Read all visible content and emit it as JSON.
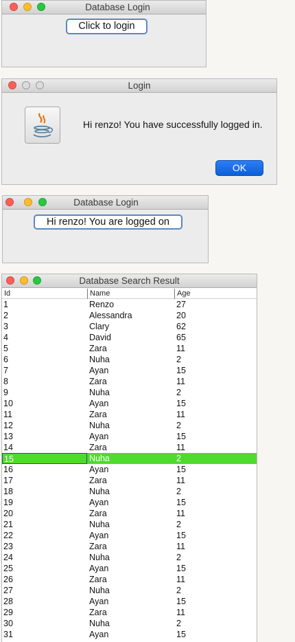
{
  "window1": {
    "title": "Database Login",
    "button_label": "Click to login"
  },
  "dialog": {
    "title": "Login",
    "message": "Hi renzo! You have successfully logged in.",
    "ok_label": "OK",
    "icon": "java-icon"
  },
  "window3": {
    "title": "Database Login",
    "button_label": "Hi renzo!  You are logged on"
  },
  "table_window": {
    "title": "Database Search Result",
    "columns": [
      "Id",
      "Name",
      "Age"
    ],
    "selected_row_id": "15",
    "selection_color": "#4fdb2d",
    "rows": [
      {
        "id": "1",
        "name": "Renzo",
        "age": "27"
      },
      {
        "id": "2",
        "name": "Alessandra",
        "age": "20"
      },
      {
        "id": "3",
        "name": "Clary",
        "age": "62"
      },
      {
        "id": "4",
        "name": "David",
        "age": "65"
      },
      {
        "id": "5",
        "name": "Zara",
        "age": "11"
      },
      {
        "id": "6",
        "name": "Nuha",
        "age": "2"
      },
      {
        "id": "7",
        "name": "Ayan",
        "age": "15"
      },
      {
        "id": "8",
        "name": "Zara",
        "age": "11"
      },
      {
        "id": "9",
        "name": "Nuha",
        "age": "2"
      },
      {
        "id": "10",
        "name": "Ayan",
        "age": "15"
      },
      {
        "id": "11",
        "name": "Zara",
        "age": "11"
      },
      {
        "id": "12",
        "name": "Nuha",
        "age": "2"
      },
      {
        "id": "13",
        "name": "Ayan",
        "age": "15"
      },
      {
        "id": "14",
        "name": "Zara",
        "age": "11"
      },
      {
        "id": "15",
        "name": "Nuha",
        "age": "2"
      },
      {
        "id": "16",
        "name": "Ayan",
        "age": "15"
      },
      {
        "id": "17",
        "name": "Zara",
        "age": "11"
      },
      {
        "id": "18",
        "name": "Nuha",
        "age": "2"
      },
      {
        "id": "19",
        "name": "Ayan",
        "age": "15"
      },
      {
        "id": "20",
        "name": "Zara",
        "age": "11"
      },
      {
        "id": "21",
        "name": "Nuha",
        "age": "2"
      },
      {
        "id": "22",
        "name": "Ayan",
        "age": "15"
      },
      {
        "id": "23",
        "name": "Zara",
        "age": "11"
      },
      {
        "id": "24",
        "name": "Nuha",
        "age": "2"
      },
      {
        "id": "25",
        "name": "Ayan",
        "age": "15"
      },
      {
        "id": "26",
        "name": "Zara",
        "age": "11"
      },
      {
        "id": "27",
        "name": "Nuha",
        "age": "2"
      },
      {
        "id": "28",
        "name": "Ayan",
        "age": "15"
      },
      {
        "id": "29",
        "name": "Zara",
        "age": "11"
      },
      {
        "id": "30",
        "name": "Nuha",
        "age": "2"
      },
      {
        "id": "31",
        "name": "Ayan",
        "age": "15"
      }
    ]
  }
}
